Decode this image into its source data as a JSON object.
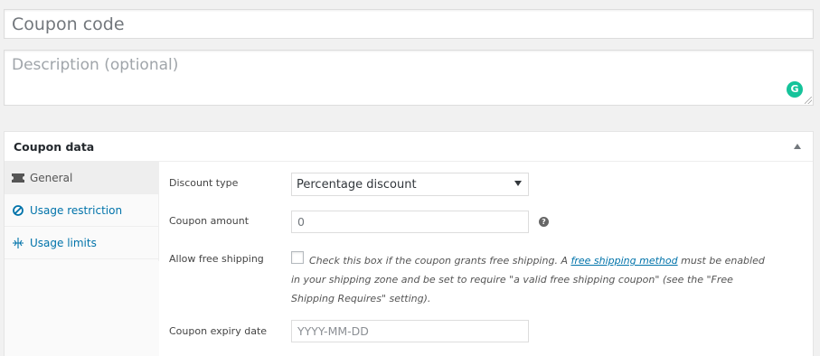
{
  "coupon_code": {
    "placeholder": "Coupon code",
    "value": ""
  },
  "description": {
    "placeholder": "Description (optional)",
    "value": ""
  },
  "grammarly": {
    "badge": "G",
    "icon": "grammarly-icon",
    "color": "#15c39a"
  },
  "coupon_data": {
    "title": "Coupon data",
    "tabs": [
      {
        "label": "General",
        "icon": "ticket-icon",
        "active": true
      },
      {
        "label": "Usage restriction",
        "icon": "block-icon",
        "active": false
      },
      {
        "label": "Usage limits",
        "icon": "limits-icon",
        "active": false
      }
    ],
    "general": {
      "discount_type": {
        "label": "Discount type",
        "selected": "Percentage discount"
      },
      "coupon_amount": {
        "label": "Coupon amount",
        "value": "0",
        "help": "?"
      },
      "free_shipping": {
        "label": "Allow free shipping",
        "checked": false,
        "text_before": "Check this box if the coupon grants free shipping. A ",
        "link_text": "free shipping method",
        "text_after": " must be enabled in your shipping zone and be set to require \"a valid free shipping coupon\" (see the \"Free Shipping Requires\" setting)."
      },
      "expiry_date": {
        "label": "Coupon expiry date",
        "placeholder": "YYYY-MM-DD",
        "value": ""
      }
    }
  },
  "colors": {
    "link": "#0073aa",
    "background": "#f1f1f1",
    "text": "#444444"
  }
}
